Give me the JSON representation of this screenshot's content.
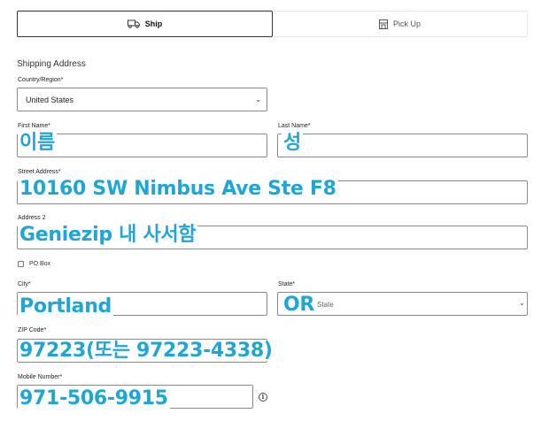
{
  "tabs": [
    {
      "label": "Ship",
      "icon": "truck-icon",
      "active": true
    },
    {
      "label": "Pick Up",
      "icon": "store-icon",
      "active": false
    }
  ],
  "section_title": "Shipping Address",
  "country": {
    "label": "Country/Region*",
    "value": "United States"
  },
  "first_name": {
    "label": "First Name*",
    "overlay": "이름"
  },
  "last_name": {
    "label": "Last Name*",
    "overlay": "성"
  },
  "street": {
    "label": "Street Address*",
    "overlay": "10160 SW Nimbus Ave Ste F8"
  },
  "address2": {
    "label": "Address 2",
    "overlay": "Geniezip 내 사서함"
  },
  "po_box": {
    "label": "PO Box"
  },
  "city": {
    "label": "City*",
    "overlay": "Portland"
  },
  "state": {
    "label": "State*",
    "value": "State",
    "overlay": "OR"
  },
  "zip": {
    "label": "ZIP Code*",
    "overlay": "97223(또는 97223-4338)"
  },
  "mobile": {
    "label": "Mobile Number*",
    "overlay": "971-506-9915"
  },
  "info_icon_glyph": "i",
  "accent_color": "#1fa6d6"
}
